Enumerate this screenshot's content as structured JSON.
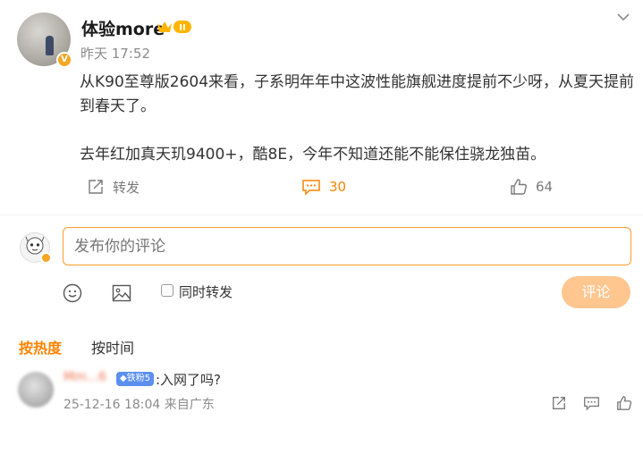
{
  "post": {
    "author": "体验more",
    "time": "昨天 17:52",
    "verified_badge": "V",
    "member_badge": "II",
    "text_line1": "从K90至尊版2604来看，子系明年年中这波性能旗舰进度提前不少呀，从夏天提前",
    "text_line2": "到春天了。",
    "text_line3": "去年红加真天玑9400+，酷8E，今年不知道还能不能保住骁龙独苗。",
    "actions": {
      "repost_label": "转发",
      "comment_count": "30",
      "like_count": "64"
    }
  },
  "composer": {
    "placeholder": "发布你的评论",
    "repost_option": "同时转发",
    "submit_label": "评论"
  },
  "sort": {
    "hot": "按热度",
    "time": "按时间"
  },
  "comments": [
    {
      "user": "Mm...6",
      "fan_badge": "◆铁粉5",
      "text": ":入网了吗?",
      "meta": "25-12-16 18:04 来自广东"
    }
  ],
  "colors": {
    "accent": "#ff8200",
    "submit_disabled": "#ffc690",
    "input_border": "#ff9a2e",
    "fan_badge": "#5b8ff0"
  }
}
